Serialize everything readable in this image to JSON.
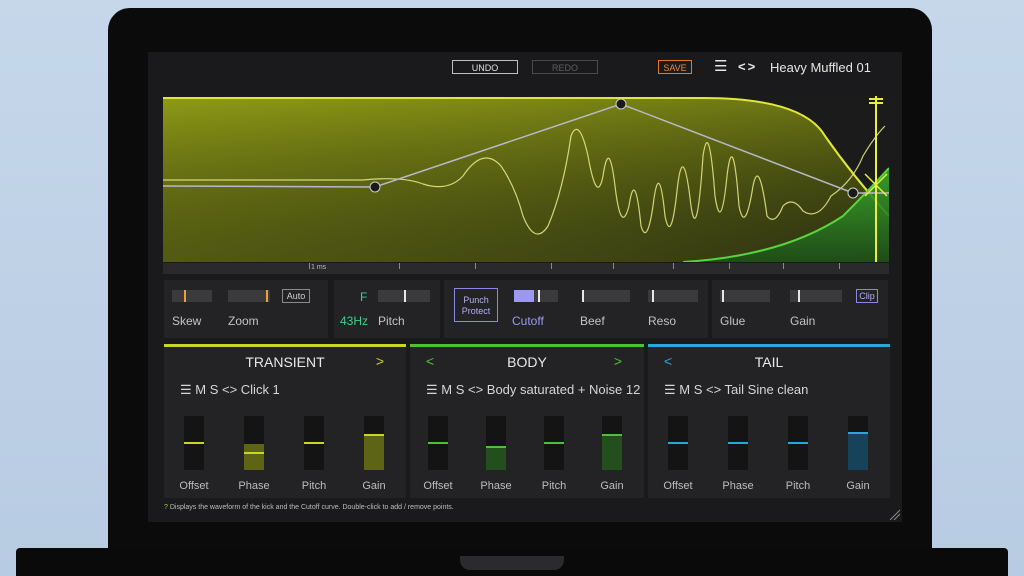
{
  "topbar": {
    "undo": "UNDO",
    "redo": "REDO",
    "save": "SAVE",
    "menu_icon": "☰",
    "nav_icon": "<>",
    "preset": "Heavy Muffled 01"
  },
  "ruler": {
    "label": "1 ms"
  },
  "controls": {
    "skew": "Skew",
    "zoom": "Zoom",
    "auto": "Auto",
    "f": "F",
    "freq": "43Hz",
    "pitch": "Pitch",
    "punch": "Punch Protect",
    "cutoff": "Cutoff",
    "beef": "Beef",
    "reso": "Reso",
    "glue": "Glue",
    "gain": "Gain",
    "clip": "Clip"
  },
  "sections": {
    "transient": {
      "title": "TRANSIENT",
      "next": ">",
      "header": "☰ M S <> Click 1"
    },
    "body": {
      "title": "BODY",
      "prev": "<",
      "next": ">",
      "header": "☰ M S <> Body saturated + Noise 12"
    },
    "tail": {
      "title": "TAIL",
      "prev": "<",
      "header": "☰ M S <> Tail Sine clean"
    }
  },
  "faders": {
    "offset": "Offset",
    "phase": "Phase",
    "pitch": "Pitch",
    "gain": "Gain"
  },
  "colors": {
    "transient": "#c8d62a",
    "body": "#4fbf3a",
    "tail": "#2aa7d8"
  },
  "footer": {
    "help": "Displays the waveform of the kick and the Cutoff curve. Double-click to add / remove points."
  }
}
